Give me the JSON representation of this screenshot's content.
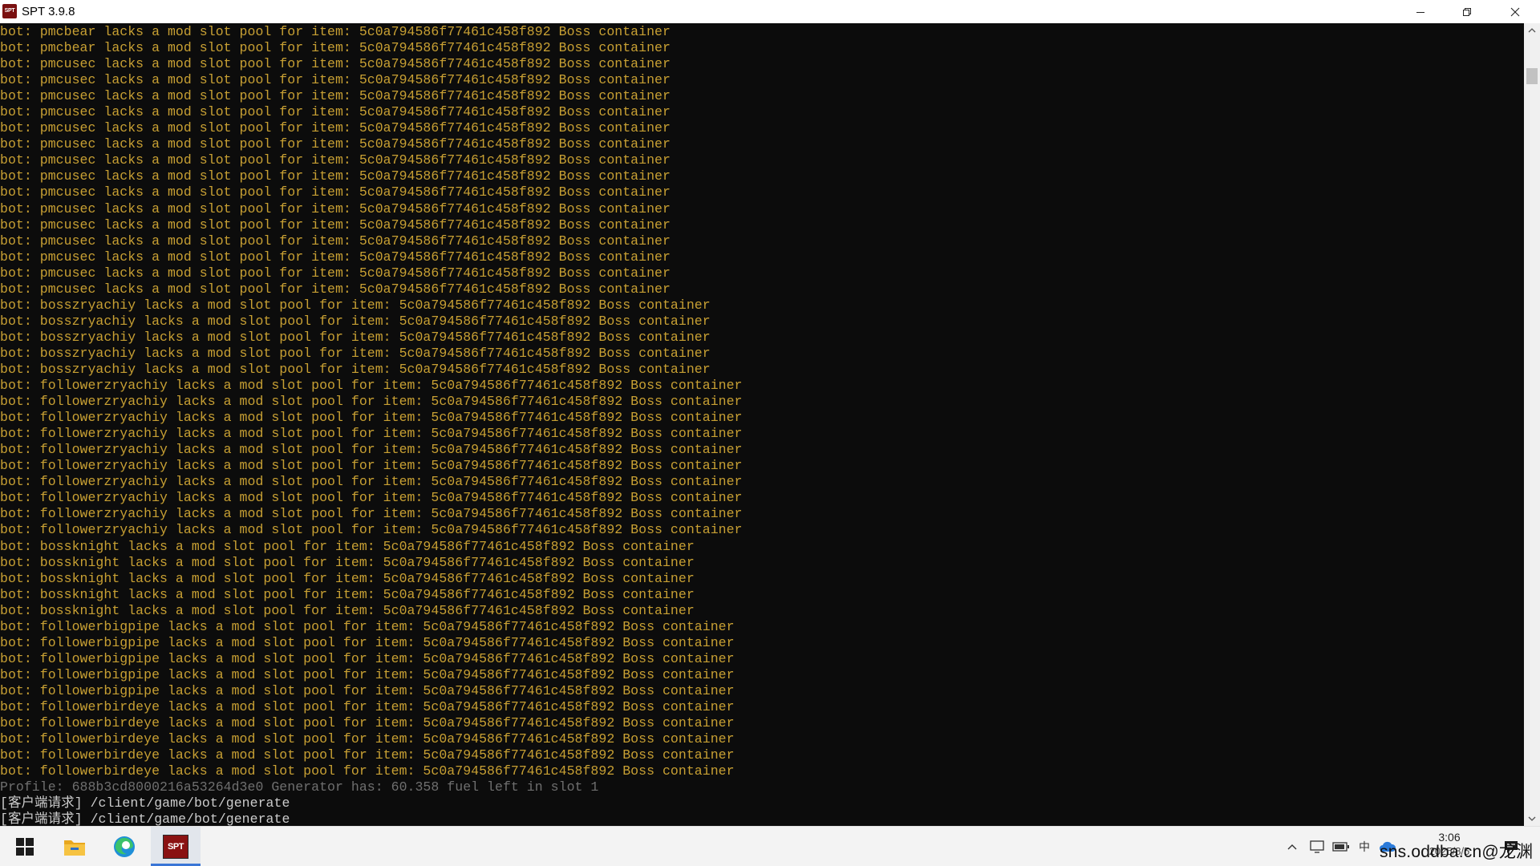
{
  "window": {
    "title": "SPT 3.9.8",
    "icon_label": "SPT"
  },
  "log_lines": [
    {
      "text": "bot: pmcbear lacks a mod slot pool for item: 5c0a794586f77461c458f892 Boss container",
      "kind": "warn"
    },
    {
      "text": "bot: pmcbear lacks a mod slot pool for item: 5c0a794586f77461c458f892 Boss container",
      "kind": "warn"
    },
    {
      "text": "bot: pmcusec lacks a mod slot pool for item: 5c0a794586f77461c458f892 Boss container",
      "kind": "warn"
    },
    {
      "text": "bot: pmcusec lacks a mod slot pool for item: 5c0a794586f77461c458f892 Boss container",
      "kind": "warn"
    },
    {
      "text": "bot: pmcusec lacks a mod slot pool for item: 5c0a794586f77461c458f892 Boss container",
      "kind": "warn"
    },
    {
      "text": "bot: pmcusec lacks a mod slot pool for item: 5c0a794586f77461c458f892 Boss container",
      "kind": "warn"
    },
    {
      "text": "bot: pmcusec lacks a mod slot pool for item: 5c0a794586f77461c458f892 Boss container",
      "kind": "warn"
    },
    {
      "text": "bot: pmcusec lacks a mod slot pool for item: 5c0a794586f77461c458f892 Boss container",
      "kind": "warn"
    },
    {
      "text": "bot: pmcusec lacks a mod slot pool for item: 5c0a794586f77461c458f892 Boss container",
      "kind": "warn"
    },
    {
      "text": "bot: pmcusec lacks a mod slot pool for item: 5c0a794586f77461c458f892 Boss container",
      "kind": "warn"
    },
    {
      "text": "bot: pmcusec lacks a mod slot pool for item: 5c0a794586f77461c458f892 Boss container",
      "kind": "warn"
    },
    {
      "text": "bot: pmcusec lacks a mod slot pool for item: 5c0a794586f77461c458f892 Boss container",
      "kind": "warn"
    },
    {
      "text": "bot: pmcusec lacks a mod slot pool for item: 5c0a794586f77461c458f892 Boss container",
      "kind": "warn"
    },
    {
      "text": "bot: pmcusec lacks a mod slot pool for item: 5c0a794586f77461c458f892 Boss container",
      "kind": "warn"
    },
    {
      "text": "bot: pmcusec lacks a mod slot pool for item: 5c0a794586f77461c458f892 Boss container",
      "kind": "warn"
    },
    {
      "text": "bot: pmcusec lacks a mod slot pool for item: 5c0a794586f77461c458f892 Boss container",
      "kind": "warn"
    },
    {
      "text": "bot: pmcusec lacks a mod slot pool for item: 5c0a794586f77461c458f892 Boss container",
      "kind": "warn"
    },
    {
      "text": "bot: bosszryachiy lacks a mod slot pool for item: 5c0a794586f77461c458f892 Boss container",
      "kind": "warn"
    },
    {
      "text": "bot: bosszryachiy lacks a mod slot pool for item: 5c0a794586f77461c458f892 Boss container",
      "kind": "warn"
    },
    {
      "text": "bot: bosszryachiy lacks a mod slot pool for item: 5c0a794586f77461c458f892 Boss container",
      "kind": "warn"
    },
    {
      "text": "bot: bosszryachiy lacks a mod slot pool for item: 5c0a794586f77461c458f892 Boss container",
      "kind": "warn"
    },
    {
      "text": "bot: bosszryachiy lacks a mod slot pool for item: 5c0a794586f77461c458f892 Boss container",
      "kind": "warn"
    },
    {
      "text": "bot: followerzryachiy lacks a mod slot pool for item: 5c0a794586f77461c458f892 Boss container",
      "kind": "warn"
    },
    {
      "text": "bot: followerzryachiy lacks a mod slot pool for item: 5c0a794586f77461c458f892 Boss container",
      "kind": "warn"
    },
    {
      "text": "bot: followerzryachiy lacks a mod slot pool for item: 5c0a794586f77461c458f892 Boss container",
      "kind": "warn"
    },
    {
      "text": "bot: followerzryachiy lacks a mod slot pool for item: 5c0a794586f77461c458f892 Boss container",
      "kind": "warn"
    },
    {
      "text": "bot: followerzryachiy lacks a mod slot pool for item: 5c0a794586f77461c458f892 Boss container",
      "kind": "warn"
    },
    {
      "text": "bot: followerzryachiy lacks a mod slot pool for item: 5c0a794586f77461c458f892 Boss container",
      "kind": "warn"
    },
    {
      "text": "bot: followerzryachiy lacks a mod slot pool for item: 5c0a794586f77461c458f892 Boss container",
      "kind": "warn"
    },
    {
      "text": "bot: followerzryachiy lacks a mod slot pool for item: 5c0a794586f77461c458f892 Boss container",
      "kind": "warn"
    },
    {
      "text": "bot: followerzryachiy lacks a mod slot pool for item: 5c0a794586f77461c458f892 Boss container",
      "kind": "warn"
    },
    {
      "text": "bot: followerzryachiy lacks a mod slot pool for item: 5c0a794586f77461c458f892 Boss container",
      "kind": "warn"
    },
    {
      "text": "bot: bossknight lacks a mod slot pool for item: 5c0a794586f77461c458f892 Boss container",
      "kind": "warn"
    },
    {
      "text": "bot: bossknight lacks a mod slot pool for item: 5c0a794586f77461c458f892 Boss container",
      "kind": "warn"
    },
    {
      "text": "bot: bossknight lacks a mod slot pool for item: 5c0a794586f77461c458f892 Boss container",
      "kind": "warn"
    },
    {
      "text": "bot: bossknight lacks a mod slot pool for item: 5c0a794586f77461c458f892 Boss container",
      "kind": "warn"
    },
    {
      "text": "bot: bossknight lacks a mod slot pool for item: 5c0a794586f77461c458f892 Boss container",
      "kind": "warn"
    },
    {
      "text": "bot: followerbigpipe lacks a mod slot pool for item: 5c0a794586f77461c458f892 Boss container",
      "kind": "warn"
    },
    {
      "text": "bot: followerbigpipe lacks a mod slot pool for item: 5c0a794586f77461c458f892 Boss container",
      "kind": "warn"
    },
    {
      "text": "bot: followerbigpipe lacks a mod slot pool for item: 5c0a794586f77461c458f892 Boss container",
      "kind": "warn"
    },
    {
      "text": "bot: followerbigpipe lacks a mod slot pool for item: 5c0a794586f77461c458f892 Boss container",
      "kind": "warn"
    },
    {
      "text": "bot: followerbigpipe lacks a mod slot pool for item: 5c0a794586f77461c458f892 Boss container",
      "kind": "warn"
    },
    {
      "text": "bot: followerbirdeye lacks a mod slot pool for item: 5c0a794586f77461c458f892 Boss container",
      "kind": "warn"
    },
    {
      "text": "bot: followerbirdeye lacks a mod slot pool for item: 5c0a794586f77461c458f892 Boss container",
      "kind": "warn"
    },
    {
      "text": "bot: followerbirdeye lacks a mod slot pool for item: 5c0a794586f77461c458f892 Boss container",
      "kind": "warn"
    },
    {
      "text": "bot: followerbirdeye lacks a mod slot pool for item: 5c0a794586f77461c458f892 Boss container",
      "kind": "warn"
    },
    {
      "text": "bot: followerbirdeye lacks a mod slot pool for item: 5c0a794586f77461c458f892 Boss container",
      "kind": "warn"
    },
    {
      "text": "Profile: 688b3cd8000216a53264d3e0 Generator has: 60.358 fuel left in slot 1",
      "kind": "dim"
    },
    {
      "text": "[客户端请求] /client/game/bot/generate",
      "kind": "info"
    },
    {
      "text": "[客户端请求] /client/game/bot/generate",
      "kind": "info"
    }
  ],
  "taskbar": {
    "start_icon": "windows-logo-icon",
    "pinned": [
      {
        "name": "file-explorer-icon"
      },
      {
        "name": "edge-browser-icon"
      },
      {
        "name": "spt-app-icon",
        "label": "SPT",
        "active": true
      }
    ],
    "tray": {
      "ime_label": "中",
      "time": "3:06",
      "date": "2025/8/5"
    },
    "watermark": "sns.oddba.cn@龙渊"
  },
  "colors": {
    "console_bg": "#0c0c0c",
    "warning_text": "#c8a033",
    "dim_text": "#6f6f6f",
    "info_text": "#cccccc",
    "active_taskbar_accent": "#3a76d6"
  }
}
